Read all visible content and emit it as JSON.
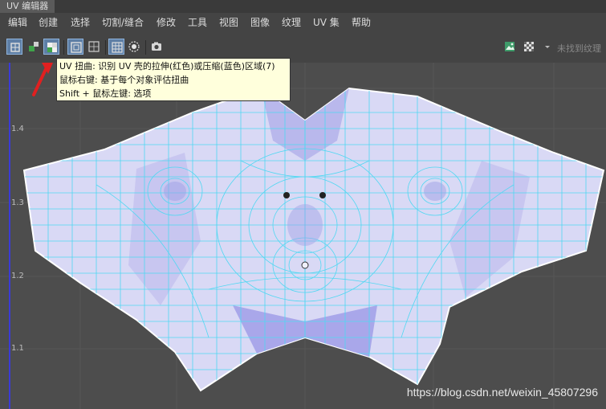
{
  "window": {
    "title": "UV 编辑器"
  },
  "menu": [
    "编辑",
    "创建",
    "选择",
    "切割/缝合",
    "修改",
    "工具",
    "视图",
    "图像",
    "纹理",
    "UV 集",
    "帮助"
  ],
  "toolbar": {
    "no_texture": "未找到纹理",
    "icons": [
      "shaded-uv-icon",
      "backface-icon",
      "uv-distortion-icon",
      "texture-border-icon",
      "uv-border-icon",
      "checker-grid-icon",
      "pixel-snap-icon",
      "snapshot-icon"
    ]
  },
  "tooltip": {
    "line1": "UV 扭曲: 识别 UV 壳的拉伸(红色)或压缩(蓝色)区域(7)",
    "line2": "鼠标右键: 基于每个对象评估扭曲",
    "line3": "Shift + 鼠标左键: 选项"
  },
  "axis": {
    "ticks": [
      "1.4",
      "1.3",
      "1.2",
      "1.1"
    ]
  },
  "watermark": "https://blog.csdn.net/weixin_45807296",
  "colors": {
    "uv_shell": "#d9d9f5",
    "wireframe": "#4fd8f2",
    "highlight": "#5e7fa6",
    "annotation_arrow": "#e02020"
  }
}
